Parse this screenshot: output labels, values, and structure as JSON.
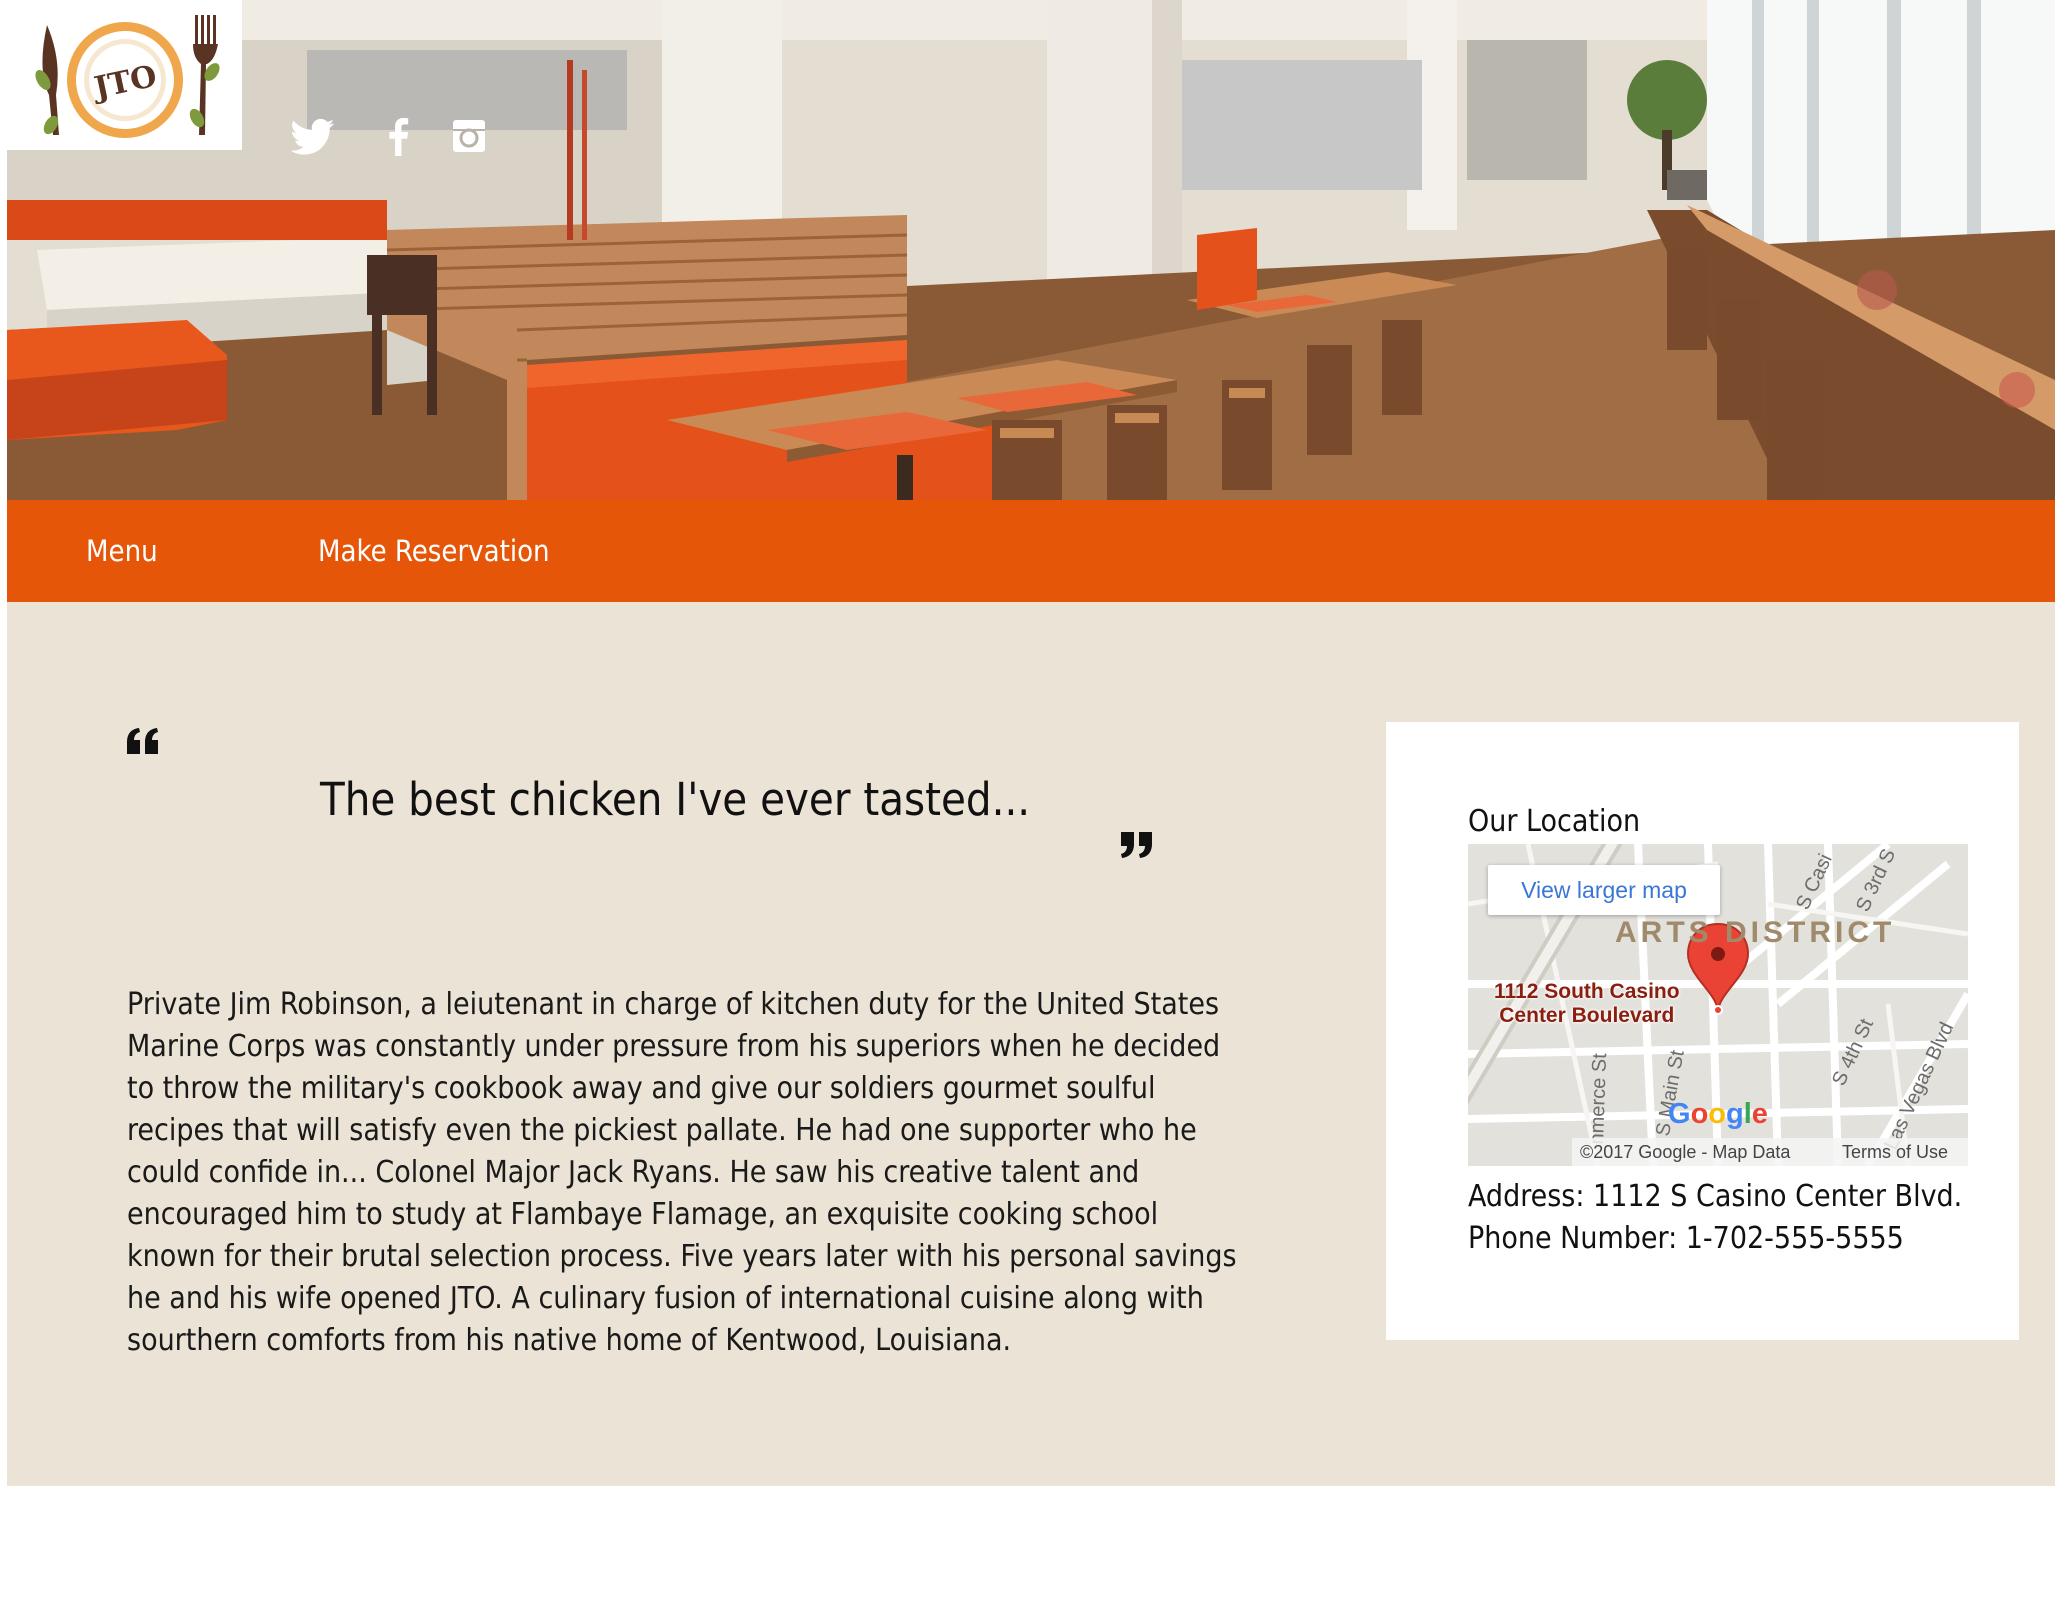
{
  "brand": {
    "logo_text": "JTO"
  },
  "social": {
    "twitter": "twitter-icon",
    "facebook": "facebook-icon",
    "instagram": "instagram-icon"
  },
  "nav": {
    "items": [
      {
        "label": "Menu"
      },
      {
        "label": "Make Reservation"
      }
    ]
  },
  "testimonial": {
    "quote": "The best chicken I've ever tasted...",
    "story": "Private Jim Robinson, a leiutenant in charge of kitchen duty for the United States Marine Corps was constantly under pressure from his superiors when he decided to throw the military's cookbook away and give our soldiers gourmet soulful recipes that will satisfy even the pickiest pallate. He had one supporter who he could confide in... Colonel Major Jack Ryans. He saw his creative talent and encouraged him to study at Flambaye Flamage, an exquisite cooking school known for their brutal selection process. Five years later with his personal savings he and his wife opened JTO. A culinary fusion of international cuisine along with sourthern comforts from his native home of Kentwood, Louisiana."
  },
  "location": {
    "title": "Our Location",
    "address": "Address: 1112 S Casino Center Blvd.",
    "phone": "Phone Number: 1-702-555-5555",
    "map": {
      "view_larger": "View larger map",
      "district": "ARTS DISTRICT",
      "pin_label_line1": "1112 South Casino",
      "pin_label_line2": "Center Boulevard",
      "streets": {
        "s_casino": "S Casi",
        "s_3rd": "S 3rd S",
        "s_4th": "S 4th St",
        "las_vegas": "Las Vegas Blvd",
        "commerce": "nmerce St",
        "s_main": "S Main St"
      },
      "google": "Google",
      "copyright": "©2017 Google - Map Data",
      "terms": "Terms of Use"
    }
  },
  "colors": {
    "accent": "#e55609",
    "page_bg": "#ebe3d5",
    "card_bg": "#ffffff",
    "link_blue": "#3a76d6",
    "pin_red": "#ea4335"
  }
}
